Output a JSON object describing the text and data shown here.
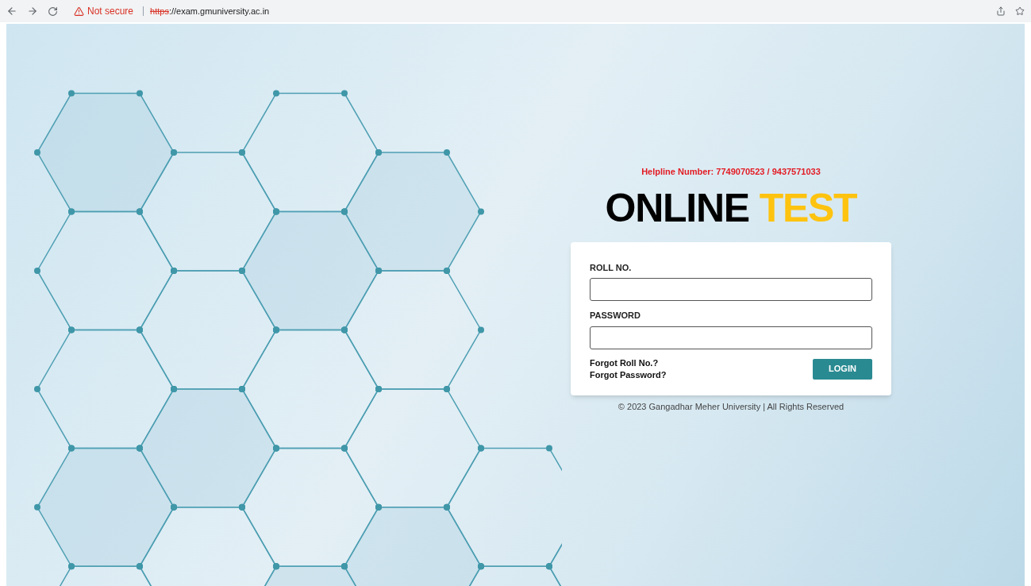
{
  "browser": {
    "security_label": "Not secure",
    "url_scheme": "https",
    "url_rest": "://exam.gmuniversity.ac.in"
  },
  "helpline": "Helpline Number: 7749070523 / 9437571033",
  "title": {
    "primary": "ONLINE",
    "accent": "TEST"
  },
  "form": {
    "fields": [
      {
        "label": "ROLL NO."
      },
      {
        "label": "PASSWORD"
      }
    ],
    "links": [
      "Forgot Roll No.?",
      "Forgot Password?"
    ],
    "submit": "LOGIN"
  },
  "footer": "© 2023 Gangadhar Meher University | All Rights Reserved"
}
